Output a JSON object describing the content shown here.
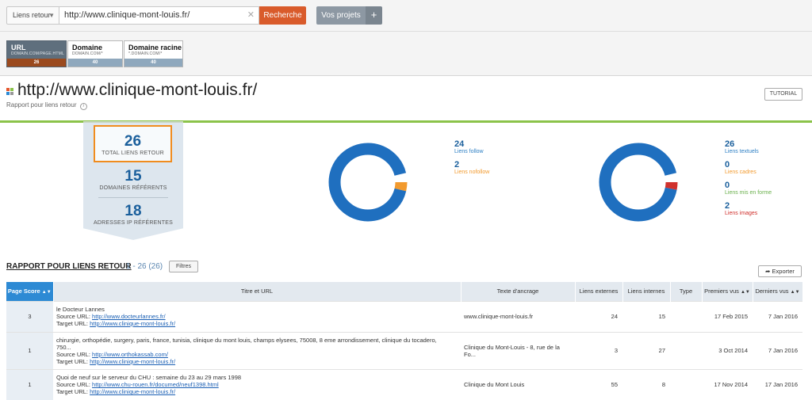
{
  "topbar": {
    "scope_label": "Liens retour",
    "url_value": "http://www.clinique-mont-louis.fr/",
    "clear_icon": "close-icon",
    "search_label": "Recherche",
    "projects_label": "Vos projets",
    "projects_plus": "+"
  },
  "scopes": [
    {
      "title": "URL",
      "hint": "DOMAIN.COM/PAGE.HTML",
      "count": "26"
    },
    {
      "title": "Domaine",
      "hint": "DOMAIN.COM/*",
      "count": "40"
    },
    {
      "title": "Domaine racine",
      "hint": "*.DOMAIN.COM/*",
      "count": "40"
    }
  ],
  "header": {
    "title": "http://www.clinique-mont-louis.fr/",
    "subtitle": "Rapport pour liens retour",
    "info_glyph": "i",
    "tutorial_label": "TUTORIAL"
  },
  "summary": {
    "total_value": "26",
    "total_label": "TOTAL LIENS RETOUR",
    "domains_value": "15",
    "domains_label": "DOMAINES RÉFÉRENTS",
    "ips_value": "18",
    "ips_label": "ADRESSES IP RÉFÉRENTES"
  },
  "donut_follow": {
    "items": [
      {
        "value": "24",
        "label": "Liens follow",
        "color": "#1f6fbf"
      },
      {
        "value": "2",
        "label": "Liens nofollow",
        "color": "#f29a2e"
      }
    ]
  },
  "donut_types": {
    "items": [
      {
        "value": "26",
        "label": "Liens textuels",
        "color": "#1f6fbf"
      },
      {
        "value": "0",
        "label": "Liens cadres",
        "color": "#f29a2e"
      },
      {
        "value": "0",
        "label": "Liens mis en forme",
        "color": "#6ab04c"
      },
      {
        "value": "2",
        "label": "Liens images",
        "color": "#d0312d"
      }
    ]
  },
  "table": {
    "section_title": "RAPPORT POUR LIENS RETOUR",
    "range": "1 - 26 (26)",
    "filters_label": "Filtres",
    "export_label": "Exporter",
    "columns": [
      "Page Score",
      "Titre et URL",
      "Texte d'ancrage",
      "Liens externes",
      "Liens internes",
      "Type",
      "Premiers vus",
      "Derniers vus"
    ],
    "source_prefix": "Source URL: ",
    "target_prefix": "Target URL: ",
    "rows": [
      {
        "score": "3",
        "title": "le Docteur Lannes",
        "title2": "",
        "source": "http://www.docteurlannes.fr/",
        "target": "http://www.clinique-mont-louis.fr/",
        "anchor": "www.clinique-mont-louis.fr",
        "anchor2": "",
        "external": "24",
        "internal": "15",
        "type": "",
        "first_seen": "17 Feb 2015",
        "last_seen": "7 Jan 2016"
      },
      {
        "score": "1",
        "title": "chirurgie, orthopédie, surgery, paris, france, tunisia, clinique du mont louis, champs elysees, 75008, 8 eme arrondissement, clinique du tocadero,",
        "title2": "750...",
        "source": "http://www.orthokassab.com/",
        "target": "http://www.clinique-mont-louis.fr/",
        "anchor": "Clinique du Mont-Louis - 8, rue de la",
        "anchor2": "Fo...",
        "external": "3",
        "internal": "27",
        "type": "",
        "first_seen": "3 Oct 2014",
        "last_seen": "7 Jan 2016"
      },
      {
        "score": "1",
        "title": "Quoi de neuf sur le serveur du CHU : semaine du 23 au 29 mars 1998",
        "title2": "",
        "source": "http://www.chu-rouen.fr/documed/neuf1398.html",
        "target": "http://www.clinique-mont-louis.fr/",
        "anchor": "Clinique du Mont Louis",
        "anchor2": "",
        "external": "55",
        "internal": "8",
        "type": "",
        "first_seen": "17 Nov 2014",
        "last_seen": "17 Jan 2016"
      }
    ]
  }
}
